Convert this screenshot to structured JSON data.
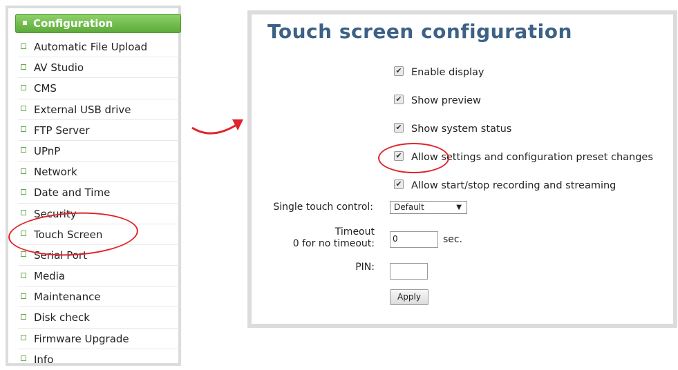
{
  "sidebar": {
    "header": "Configuration",
    "items": [
      "Automatic File Upload",
      "AV Studio",
      "CMS",
      "External USB drive",
      "FTP Server",
      "UPnP",
      "Network",
      "Date and Time",
      "Security",
      "Touch Screen",
      "Serial Port",
      "Media",
      "Maintenance",
      "Disk check",
      "Firmware Upgrade",
      "Info"
    ]
  },
  "panel": {
    "title": "Touch screen configuration",
    "checkboxes": [
      {
        "label": "Enable display",
        "checked": true
      },
      {
        "label": "Show preview",
        "checked": true
      },
      {
        "label": "Show system status",
        "checked": true
      },
      {
        "label": "Allow settings and configuration preset changes",
        "checked": true
      },
      {
        "label": "Allow start/stop recording and streaming",
        "checked": true
      }
    ],
    "single_touch_label": "Single touch control:",
    "single_touch_value": "Default",
    "timeout_label_line1": "Timeout",
    "timeout_label_line2": "0 for no timeout:",
    "timeout_value": "0",
    "timeout_unit": "sec.",
    "pin_label": "PIN:",
    "pin_value": "",
    "apply_label": "Apply"
  },
  "colors": {
    "accent_green": "#5cab3a",
    "title_blue": "#3d6186",
    "highlight_red": "#e0242b"
  }
}
